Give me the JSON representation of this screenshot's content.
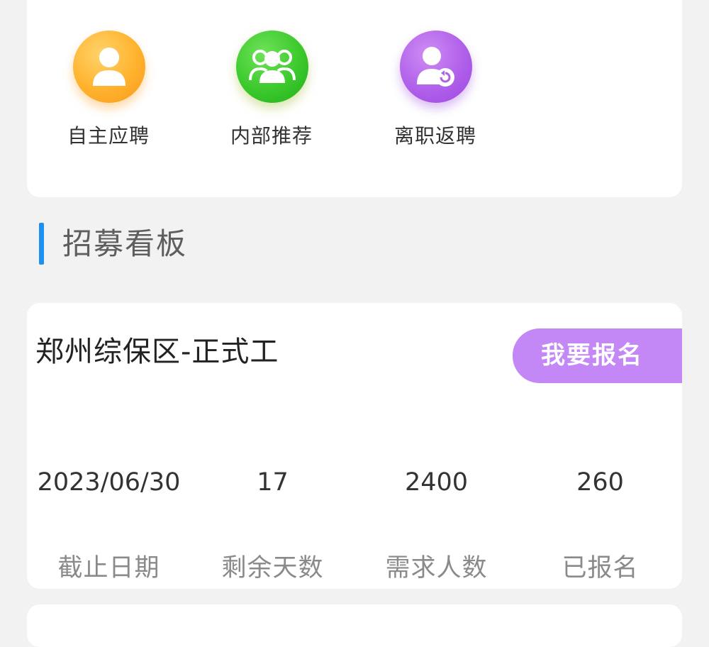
{
  "entries": [
    {
      "label": "自主应聘",
      "icon": "user-icon",
      "color": "#ffb22e"
    },
    {
      "label": "内部推荐",
      "icon": "group-icon",
      "color": "#3cc92c"
    },
    {
      "label": "离职返聘",
      "icon": "user-return-icon",
      "color": "#b060ea"
    }
  ],
  "section": {
    "title": "招募看板",
    "accent_color": "#1e90f0"
  },
  "job": {
    "title": "郑州综保区-正式工",
    "apply_label": "我要报名",
    "apply_color": "#c488f6",
    "stats": [
      {
        "value": "2023/06/30",
        "label": "截止日期"
      },
      {
        "value": "17",
        "label": "剩余天数"
      },
      {
        "value": "2400",
        "label": "需求人数"
      },
      {
        "value": "260",
        "label": "已报名"
      }
    ]
  }
}
